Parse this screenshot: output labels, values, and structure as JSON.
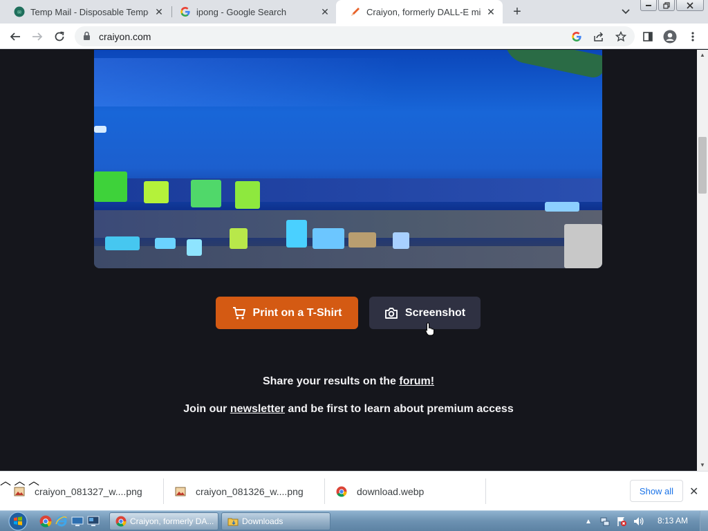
{
  "browser": {
    "tabs": [
      {
        "title": "Temp Mail - Disposable Tempora",
        "favicon": "temp-mail-icon",
        "active": false
      },
      {
        "title": "ipong - Google Search",
        "favicon": "google-g-icon",
        "active": false
      },
      {
        "title": "Craiyon, formerly DALL-E mini",
        "favicon": "crayon-icon",
        "active": true
      }
    ],
    "new_tab_symbol": "+",
    "close_symbol": "✕",
    "url": "craiyon.com"
  },
  "page": {
    "buttons": {
      "tshirt": "Print on a T-Shirt",
      "screenshot": "Screenshot"
    },
    "share": {
      "prefix": "Share your results on the ",
      "link": "forum!"
    },
    "join": {
      "prefix": "Join our ",
      "link": "newsletter",
      "suffix": " and be first to learn about premium access"
    },
    "colors": {
      "background": "#15161c",
      "tshirt_button": "#d45a13",
      "screenshot_button": "#2f3142"
    }
  },
  "downloads": {
    "items": [
      {
        "name": "craiyon_081327_w....png",
        "icon": "image-file-icon"
      },
      {
        "name": "craiyon_081326_w....png",
        "icon": "image-file-icon"
      },
      {
        "name": "download.webp",
        "icon": "chrome-icon"
      }
    ],
    "show_all": "Show all"
  },
  "taskbar": {
    "windows": [
      {
        "label": "Craiyon, formerly DA...",
        "icon": "chrome-icon",
        "active": true
      },
      {
        "label": "Downloads",
        "icon": "folder-icon",
        "active": false
      }
    ],
    "clock": "8:13 AM"
  }
}
